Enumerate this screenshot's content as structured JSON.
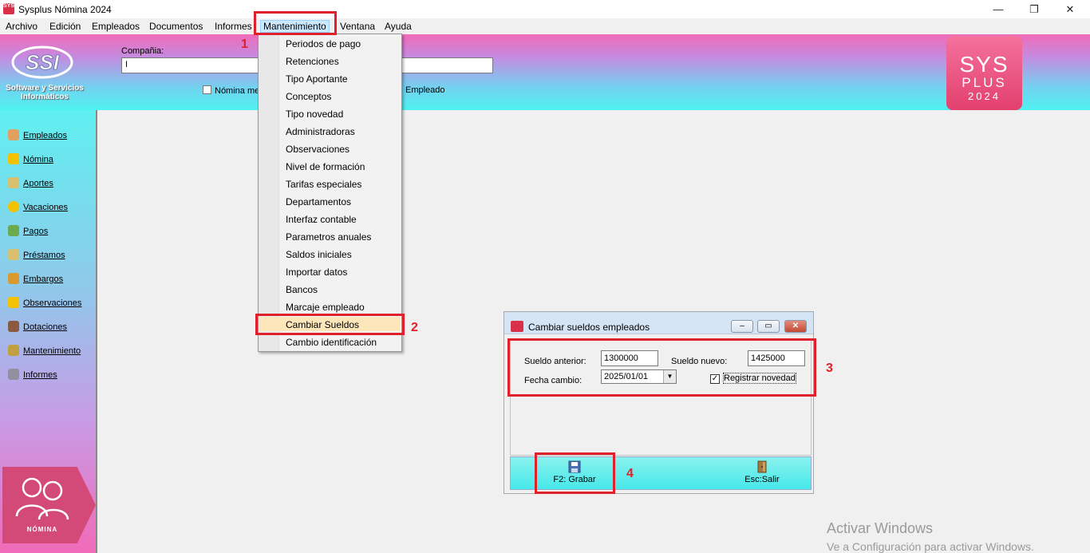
{
  "window": {
    "title": "Sysplus Nómina 2024",
    "minimize": "—",
    "restore": "❐",
    "close": "✕"
  },
  "menubar": {
    "items": [
      "Archivo",
      "Edición",
      "Empleados",
      "Documentos",
      "Informes",
      "Mantenimiento",
      "Ventana",
      "Ayuda"
    ]
  },
  "header": {
    "logo_text": "SSI",
    "logo_caption": "Software y Servicios Informáticos",
    "company_label": "Compañia:",
    "company_value": "I",
    "nomina_button": "Nómina me",
    "empleado_button": "Empleado",
    "sys_logo": [
      "SYS",
      "PLUS",
      "2024"
    ]
  },
  "sidebar": {
    "items": [
      {
        "label": "Empleados",
        "icon": "people-icon",
        "color": "#e0a060"
      },
      {
        "label": "Nómina",
        "icon": "lightning-icon",
        "color": "#f2c200"
      },
      {
        "label": "Aportes",
        "icon": "document-icon",
        "color": "#d9c070"
      },
      {
        "label": "Vacaciones",
        "icon": "sun-icon",
        "color": "#f2c200"
      },
      {
        "label": "Pagos",
        "icon": "money-icon",
        "color": "#6aaa50"
      },
      {
        "label": "Préstamos",
        "icon": "notes-icon",
        "color": "#d9c070"
      },
      {
        "label": "Embargos",
        "icon": "lock-icon",
        "color": "#d99b30"
      },
      {
        "label": "Observaciones",
        "icon": "warning-icon",
        "color": "#f2c200"
      },
      {
        "label": "Dotaciones",
        "icon": "person-icon",
        "color": "#8a5a40"
      },
      {
        "label": "Mantenimiento",
        "icon": "tools-icon",
        "color": "#c0a040"
      },
      {
        "label": "Informes",
        "icon": "printer-icon",
        "color": "#9090a0"
      }
    ],
    "badge_label": "NÓMINA"
  },
  "mantenimiento_menu": {
    "items": [
      "Periodos de pago",
      "Retenciones",
      "Tipo Aportante",
      "Conceptos",
      "Tipo novedad",
      "Administradoras",
      "Observaciones",
      "Nivel de formación",
      "Tarifas especiales",
      "Departamentos",
      "Interfaz contable",
      "Parametros anuales",
      "Saldos iniciales",
      "Importar datos",
      "Bancos",
      "Marcaje empleado",
      "Cambiar Sueldos",
      "Cambio identificación"
    ],
    "highlighted": "Cambiar Sueldos"
  },
  "dialog": {
    "title": "Cambiar sueldos empleados",
    "sueldo_anterior_label": "Sueldo anterior:",
    "sueldo_anterior_value": "1300000",
    "sueldo_nuevo_label": "Sueldo nuevo:",
    "sueldo_nuevo_value": "1425000",
    "fecha_label": "Fecha cambio:",
    "fecha_value": "2025/01/01",
    "registrar_label": "Registrar novedad",
    "registrar_checked": "✓",
    "grabar_label": "F2: Grabar",
    "salir_label": "Esc:Salir"
  },
  "annotations": [
    "1",
    "2",
    "3",
    "4"
  ],
  "watermark": {
    "line1": "Activar Windows",
    "line2": "Ve a Configuración para activar Windows."
  },
  "colors": {
    "accent_red": "#e0202a",
    "menu_highlight": "#fde6ba",
    "header_pink": "#f06bb8",
    "header_cyan": "#4ef2f0"
  }
}
